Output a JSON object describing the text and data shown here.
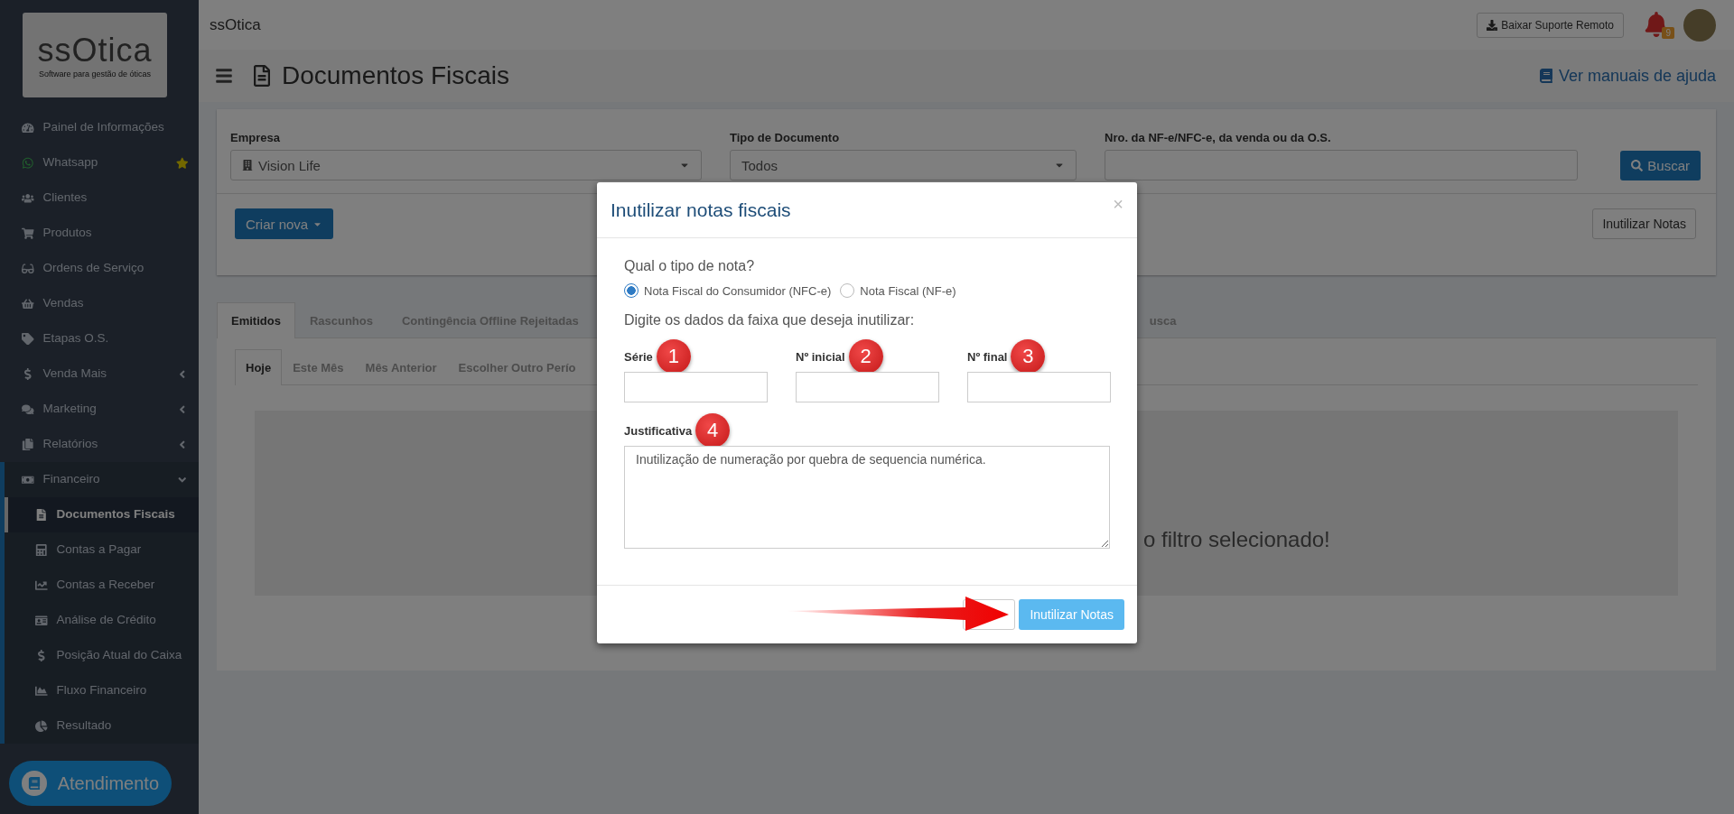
{
  "sidebar": {
    "logo": {
      "name": "ssOtica",
      "tagline": "Software para gestão de óticas"
    },
    "items": [
      {
        "label": "Painel de Informações",
        "starred": false,
        "has_submenu": false,
        "expanded": false
      },
      {
        "label": "Whatsapp",
        "starred": true,
        "has_submenu": false,
        "expanded": false
      },
      {
        "label": "Clientes",
        "starred": false,
        "has_submenu": false,
        "expanded": false
      },
      {
        "label": "Produtos",
        "starred": false,
        "has_submenu": false,
        "expanded": false
      },
      {
        "label": "Ordens de Serviço",
        "starred": false,
        "has_submenu": false,
        "expanded": false
      },
      {
        "label": "Vendas",
        "starred": false,
        "has_submenu": false,
        "expanded": false
      },
      {
        "label": "Etapas O.S.",
        "starred": false,
        "has_submenu": false,
        "expanded": false
      },
      {
        "label": "Venda Mais",
        "starred": false,
        "has_submenu": true,
        "expanded": false
      },
      {
        "label": "Marketing",
        "starred": false,
        "has_submenu": true,
        "expanded": false
      },
      {
        "label": "Relatórios",
        "starred": false,
        "has_submenu": true,
        "expanded": false
      },
      {
        "label": "Financeiro",
        "starred": false,
        "has_submenu": true,
        "expanded": true,
        "children": [
          {
            "label": "Documentos Fiscais",
            "selected": true
          },
          {
            "label": "Contas a Pagar",
            "selected": false
          },
          {
            "label": "Contas a Receber",
            "selected": false
          },
          {
            "label": "Análise de Crédito",
            "selected": false
          },
          {
            "label": "Posição Atual do Caixa",
            "selected": false
          },
          {
            "label": "Fluxo Financeiro",
            "selected": false
          },
          {
            "label": "Resultado",
            "selected": false
          }
        ]
      }
    ]
  },
  "topbar": {
    "logo": "ssOtica",
    "support_button": "Baixar Suporte Remoto",
    "notifications": "9"
  },
  "header": {
    "title": "Documentos Fiscais",
    "help_link": "Ver manuais de ajuda"
  },
  "filters": {
    "fields": [
      {
        "label": "Empresa",
        "value": "Vision Life",
        "kind": "select"
      },
      {
        "label": "Tipo de Documento",
        "value": "Todos",
        "kind": "select"
      },
      {
        "label": "Nro. da NF-e/NFC-e, da venda ou da O.S.",
        "kind": "text"
      }
    ],
    "search_button": "Buscar",
    "create_button": "Criar nova",
    "void_button": "Inutilizar Notas"
  },
  "tabs": [
    {
      "label": "Emitidos",
      "selected": true
    },
    {
      "label": "Rascunhos",
      "selected": false
    },
    {
      "label": "Contingência Offline Rejeitadas",
      "selected": false
    },
    {
      "label": "usca",
      "selected": false
    }
  ],
  "period_tabs": [
    {
      "label": "Hoje",
      "selected": true
    },
    {
      "label": "Este Mês",
      "selected": false
    },
    {
      "label": "Mês Anterior",
      "selected": false
    },
    {
      "label": "Escolher Outro Perío",
      "selected": false
    }
  ],
  "empty_message": "o filtro selecionado!",
  "modal": {
    "title": "Inutilizar notas fiscais",
    "close": "×",
    "question": "Qual o tipo de nota?",
    "radios": [
      {
        "label": "Nota Fiscal do Consumidor (NFC-e)",
        "selected": true
      },
      {
        "label": "Nota Fiscal (NF-e)",
        "selected": false
      }
    ],
    "prompt": "Digite os dados da faixa que deseja inutilizar:",
    "fields": [
      {
        "label": "Série",
        "marker": "1"
      },
      {
        "label": "Nº inicial",
        "marker": "2"
      },
      {
        "label": "Nº final",
        "marker": "3"
      }
    ],
    "justification": {
      "label": "Justificativa",
      "marker": "4",
      "value": "Inutilização de numeração por quebra de sequencia numérica."
    },
    "confirm_button": "Inutilizar Notas"
  },
  "chat_button": "Atendimento"
}
